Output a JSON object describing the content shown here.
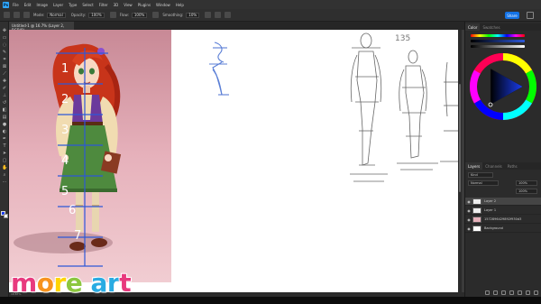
{
  "app": {
    "logo": "Ps"
  },
  "menu": {
    "items": [
      "File",
      "Edit",
      "Image",
      "Layer",
      "Type",
      "Select",
      "Filter",
      "3D",
      "View",
      "Plugins",
      "Window",
      "Help"
    ]
  },
  "options": {
    "mode_label": "Mode:",
    "mode_value": "Normal",
    "opacity_label": "Opacity:",
    "opacity_value": "100%",
    "flow_label": "Flow:",
    "flow_value": "100%",
    "smoothing_label": "Smoothing:",
    "smoothing_value": "10%",
    "share_label": "Share"
  },
  "document": {
    "tab_title": "Untitled-1 @ 16.7% (Layer 2, RGB/8)"
  },
  "status": {
    "zoom": "16.67%"
  },
  "color_panel": {
    "tabs": [
      "Color",
      "Swatches"
    ]
  },
  "layers_panel": {
    "tabs": [
      "Layers",
      "Channels",
      "Paths"
    ],
    "kind": "Kind",
    "blend": "Normal",
    "opacity": "100%",
    "fill": "100%",
    "layers": [
      {
        "name": "Layer 2",
        "selected": true
      },
      {
        "name": "Layer 1",
        "selected": false
      },
      {
        "name": "1572896429892f930d3",
        "selected": false
      },
      {
        "name": "Background",
        "selected": false
      }
    ]
  },
  "canvas": {
    "height_numbers": [
      "1",
      "2",
      "3",
      "4",
      "5",
      "6",
      "7"
    ],
    "sketch_number": "135"
  },
  "watermark": {
    "text": "more art"
  },
  "colors": {
    "accent": "#1473e6",
    "pink_bg": "#e6b1bb",
    "guide_blue": "#2d58d8",
    "watermark_letters": [
      "#e83a7e",
      "#f7931e",
      "#ffd400",
      "#8cc63f",
      "#29abe2",
      "#29abe2",
      "#e83a7e",
      "#f7931e"
    ]
  },
  "icons": [
    "move-icon",
    "marquee-icon",
    "lasso-icon",
    "brush-icon",
    "eraser-icon",
    "zoom-icon",
    "visibility-eye-icon",
    "home-icon"
  ]
}
